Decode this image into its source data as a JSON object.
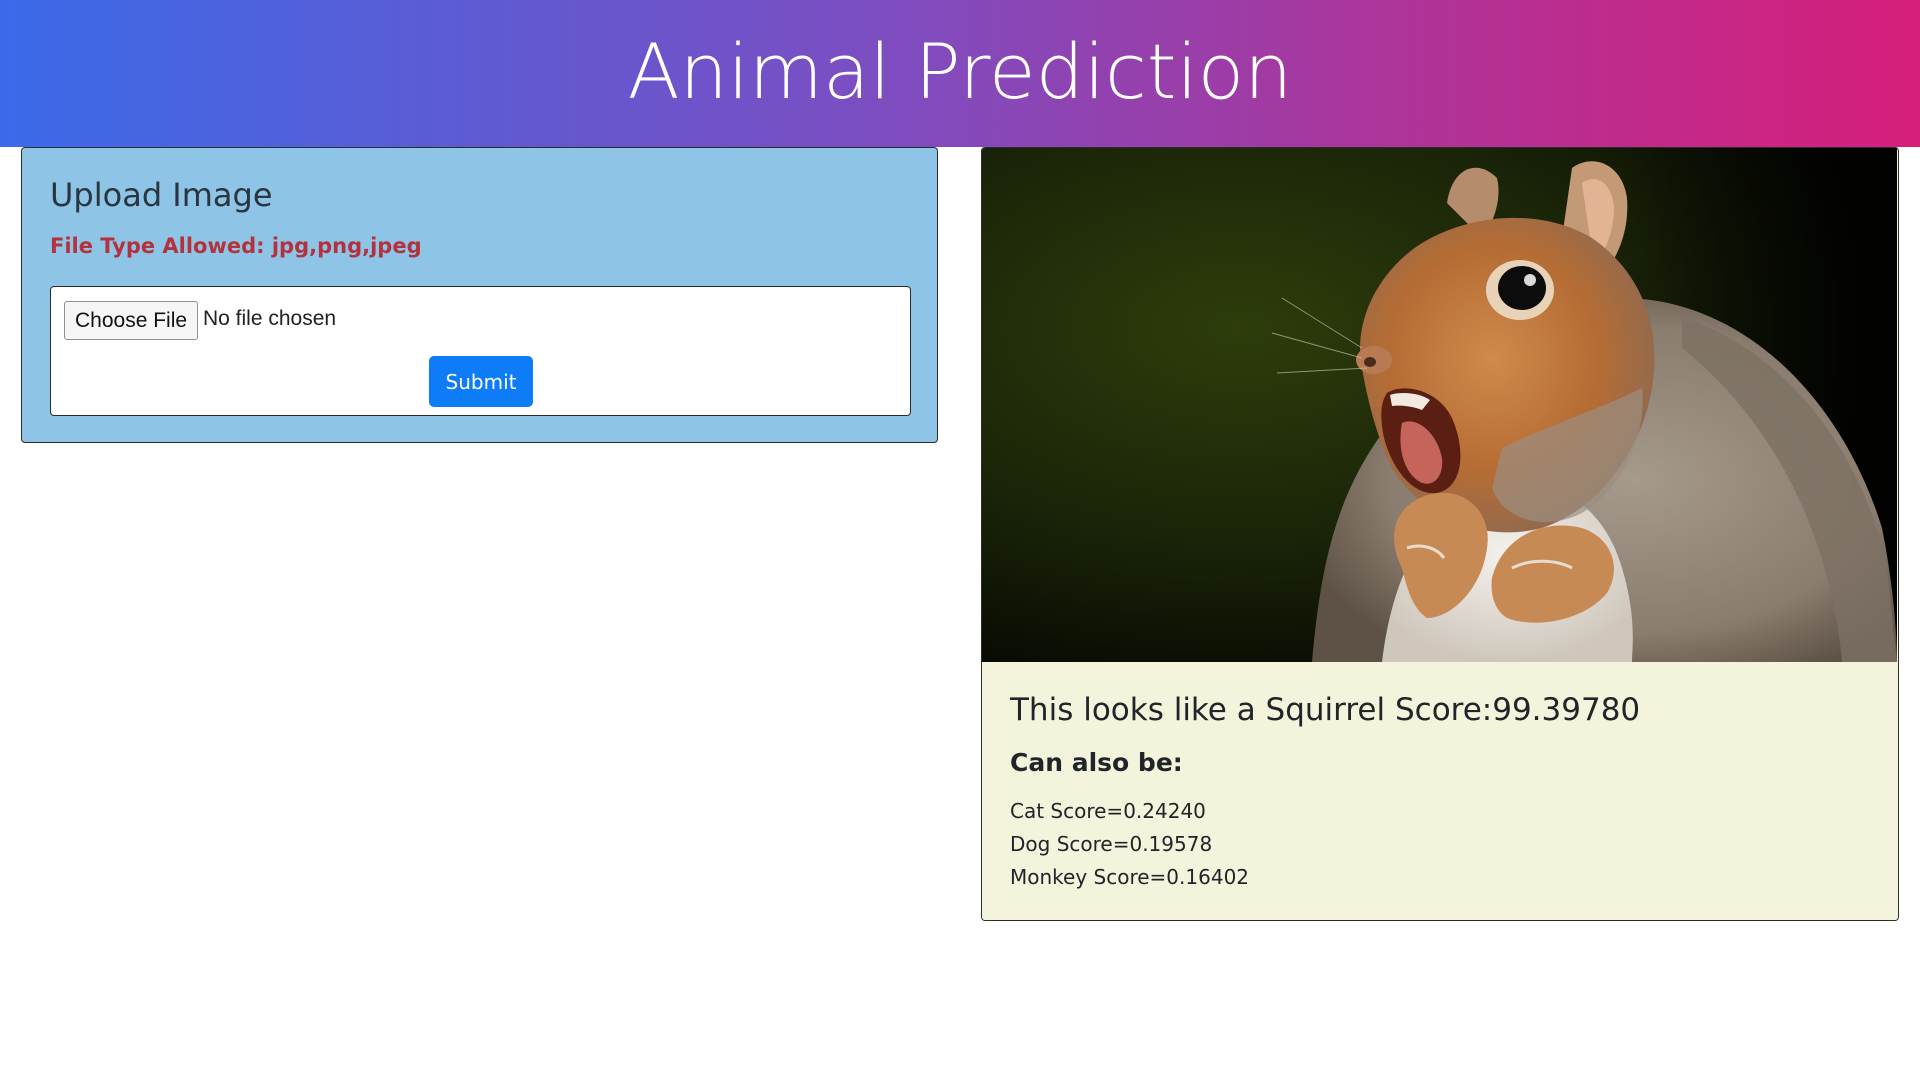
{
  "header": {
    "title": "Animal Prediction"
  },
  "upload": {
    "title": "Upload Image",
    "file_types": "File Type Allowed: jpg,png,jpeg",
    "choose_file_label": "Choose File",
    "no_file_text": "No file chosen",
    "submit_label": "Submit"
  },
  "result": {
    "image_subject": "squirrel-photo",
    "prediction": "This looks like a Squirrel Score:99.39780",
    "also_label": "Can also be:",
    "alternatives": [
      "Cat Score=0.24240",
      "Dog Score=0.19578",
      "Monkey Score=0.16402"
    ]
  },
  "colors": {
    "header_gradient_start": "#3b6ae8",
    "header_gradient_end": "#d71f7a",
    "upload_card_bg": "#8ec5e6",
    "file_type_text": "#b3323d",
    "submit_button": "#0d7cf6",
    "result_body_bg": "#f4f4dc"
  }
}
